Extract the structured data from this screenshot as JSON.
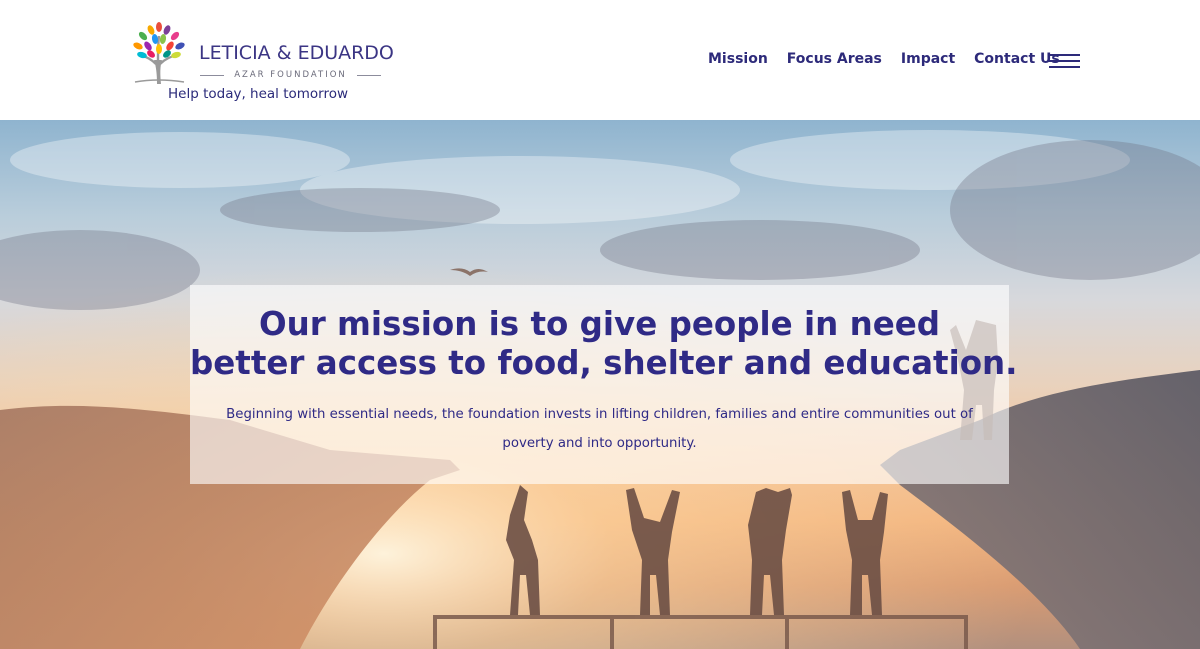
{
  "header": {
    "logo": {
      "name": "LETICIA & EDUARDO",
      "subtitle": "AZAR FOUNDATION",
      "tagline": "Help today, heal tomorrow"
    },
    "nav": [
      {
        "label": "Mission"
      },
      {
        "label": "Focus Areas"
      },
      {
        "label": "Impact"
      },
      {
        "label": "Contact Us"
      }
    ],
    "menu_icon": "hamburger-menu-icon"
  },
  "hero": {
    "title_line1": "Our mission is to give people in need",
    "title_line2": "better access to food, shelter and education.",
    "body": "Beginning with essential needs, the foundation invests in lifting children, families and entire communities out of poverty and into opportunity."
  },
  "colors": {
    "brand_navy": "#2f2a86",
    "header_bg": "#ffffff",
    "card_bg": "rgba(255,255,255,0.62)"
  }
}
